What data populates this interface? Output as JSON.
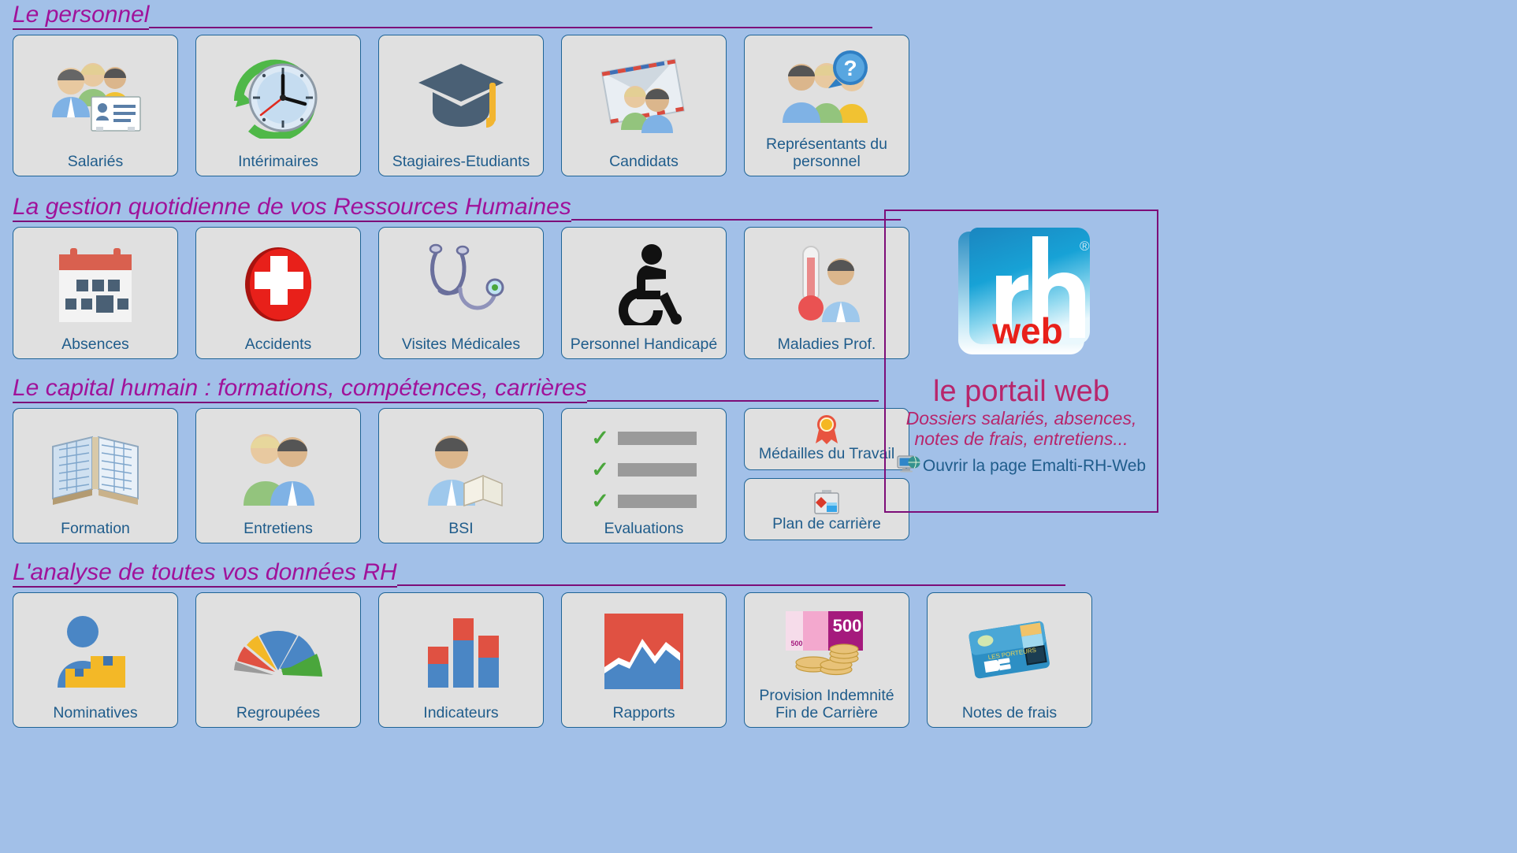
{
  "sections": [
    {
      "id": "personnel",
      "title": "Le personnel",
      "rule_width": 918,
      "tiles": [
        {
          "label": "Salariés",
          "icon": "users-id-card-icon"
        },
        {
          "label": "Intérimaires",
          "icon": "clock-arrow-icon"
        },
        {
          "label": "Stagiaires-Etudiants",
          "icon": "graduation-cap-icon"
        },
        {
          "label": "Candidats",
          "icon": "envelope-users-icon"
        },
        {
          "label": "Représentants du personnel",
          "icon": "users-question-icon"
        }
      ]
    },
    {
      "id": "gestion",
      "title": "La gestion quotidienne de vos Ressources Humaines",
      "rule_width": 418,
      "tiles": [
        {
          "label": "Absences",
          "icon": "calendar-icon"
        },
        {
          "label": "Accidents",
          "icon": "red-cross-icon"
        },
        {
          "label": "Visites Médicales",
          "icon": "stethoscope-icon"
        },
        {
          "label": "Personnel Handicapé",
          "icon": "wheelchair-icon"
        },
        {
          "label": "Maladies Prof.",
          "icon": "thermometer-person-icon"
        }
      ]
    },
    {
      "id": "capital",
      "title": "Le capital humain : formations, compétences, carrières",
      "rule_width": 370,
      "tiles": [
        {
          "label": "Formation",
          "icon": "open-book-icon"
        },
        {
          "label": "Entretiens",
          "icon": "two-people-icon"
        },
        {
          "label": "BSI",
          "icon": "person-book-icon"
        },
        {
          "label": "Evaluations",
          "icon": "checklist-icon"
        }
      ],
      "stack": [
        {
          "label": "Médailles du Travail",
          "icon": "medal-icon"
        },
        {
          "label": "Plan de carrière",
          "icon": "briefcase-icon"
        }
      ]
    },
    {
      "id": "analyse",
      "title": "L'analyse de toutes vos données RH",
      "rule_width": 848,
      "tiles": [
        {
          "label": "Nominatives",
          "icon": "person-boxes-icon"
        },
        {
          "label": "Regroupées",
          "icon": "pie-chart-icon"
        },
        {
          "label": "Indicateurs",
          "icon": "bar-chart-icon"
        },
        {
          "label": "Rapports",
          "icon": "area-chart-icon"
        },
        {
          "label": "Provision Indemnité Fin de Carrière",
          "icon": "banknote-coins-icon"
        },
        {
          "label": "Notes de frais",
          "icon": "credit-card-icon"
        }
      ]
    }
  ],
  "portal": {
    "logo_text_main": "rh",
    "logo_text_sub": "web",
    "logo_trademark": "®",
    "title": "le portail web",
    "subtitle": "Dossiers salariés, absences, notes de frais, entretiens...",
    "link_label": "Ouvrir la page Emalti-RH-Web",
    "link_icon": "monitor-globe-icon"
  },
  "colors": {
    "background": "#a2c0e8",
    "tile_face": "#e0e0e0",
    "tile_border": "#1f6496",
    "tile_label": "#1f5c8b",
    "section_heading": "#a0129a",
    "section_rule": "#7d0d78",
    "portal_border": "#7d0d78",
    "portal_text": "#b8256b"
  }
}
